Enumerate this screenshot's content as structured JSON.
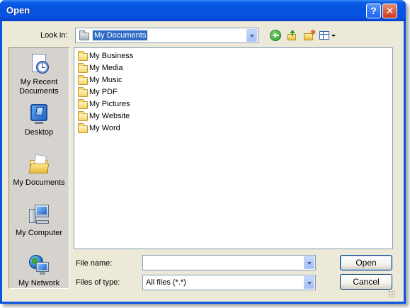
{
  "window": {
    "title": "Open",
    "help_button": "?",
    "close_button": "✕"
  },
  "toolbar": {
    "look_in_label": "Look in:",
    "look_in_value": "My Documents",
    "icons": [
      "back-icon",
      "up-folder-icon",
      "new-folder-icon",
      "views-menu-icon"
    ]
  },
  "places": [
    {
      "id": "recent",
      "label_line1": "My Recent",
      "label_line2": "Documents",
      "icon": "recent-documents-icon"
    },
    {
      "id": "desktop",
      "label_line1": "Desktop",
      "label_line2": "",
      "icon": "desktop-icon"
    },
    {
      "id": "mydocs",
      "label_line1": "My Documents",
      "label_line2": "",
      "icon": "my-documents-icon"
    },
    {
      "id": "computer",
      "label_line1": "My Computer",
      "label_line2": "",
      "icon": "my-computer-icon"
    },
    {
      "id": "network",
      "label_line1": "My Network",
      "label_line2": "",
      "icon": "my-network-icon"
    }
  ],
  "files": [
    {
      "name": "My Business"
    },
    {
      "name": "My Media"
    },
    {
      "name": "My Music"
    },
    {
      "name": "My PDF"
    },
    {
      "name": "My Pictures"
    },
    {
      "name": "My Website"
    },
    {
      "name": "My Word"
    }
  ],
  "footer": {
    "file_name_label": "File name:",
    "file_name_value": "",
    "file_type_label": "Files of type:",
    "file_type_value": "All files (*.*)",
    "open_button": "Open",
    "cancel_button": "Cancel"
  },
  "colors": {
    "title_bar": "#0a55e4",
    "dialog_face": "#ece9d8",
    "selection": "#316ac5"
  }
}
